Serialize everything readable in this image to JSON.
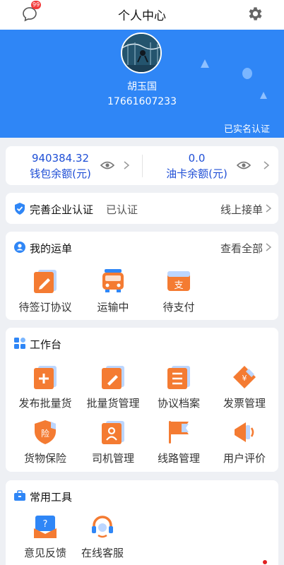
{
  "header": {
    "title": "个人中心",
    "message_badge": "99",
    "icons": {
      "left": "message-icon",
      "right": "gear-icon"
    }
  },
  "profile": {
    "name": "胡玉国",
    "phone": "17661607233",
    "verified_text": "已实名认证",
    "background_color": "#2f86f6"
  },
  "balances": [
    {
      "value": "940384.32",
      "label": "钱包余额(元)"
    },
    {
      "value": "0.0",
      "label": "油卡余额(元)"
    }
  ],
  "certification": {
    "label": "完善企业认证",
    "status": "已认证",
    "link": "线上接单"
  },
  "waybill": {
    "title": "我的运单",
    "more": "查看全部",
    "items": [
      {
        "label": "待签订协议",
        "icon": "sign-agreement-icon"
      },
      {
        "label": "运输中",
        "icon": "truck-icon"
      },
      {
        "label": "待支付",
        "icon": "pay-icon"
      }
    ]
  },
  "workbench": {
    "title": "工作台",
    "items": [
      {
        "label": "发布批量货",
        "icon": "publish-cargo-icon"
      },
      {
        "label": "批量货管理",
        "icon": "cargo-manage-icon"
      },
      {
        "label": "协议档案",
        "icon": "agreement-archive-icon"
      },
      {
        "label": "发票管理",
        "icon": "invoice-icon"
      },
      {
        "label": "货物保险",
        "icon": "insurance-icon"
      },
      {
        "label": "司机管理",
        "icon": "driver-icon"
      },
      {
        "label": "线路管理",
        "icon": "route-flag-icon"
      },
      {
        "label": "用户评价",
        "icon": "rating-icon"
      }
    ]
  },
  "tools": {
    "title": "常用工具",
    "items": [
      {
        "label": "意见反馈",
        "icon": "feedback-icon"
      },
      {
        "label": "在线客服",
        "icon": "customer-service-icon"
      }
    ]
  },
  "colors": {
    "accent": "#2f86f6",
    "value_text": "#1f4fd6",
    "icon_orange": "#f47b32"
  }
}
